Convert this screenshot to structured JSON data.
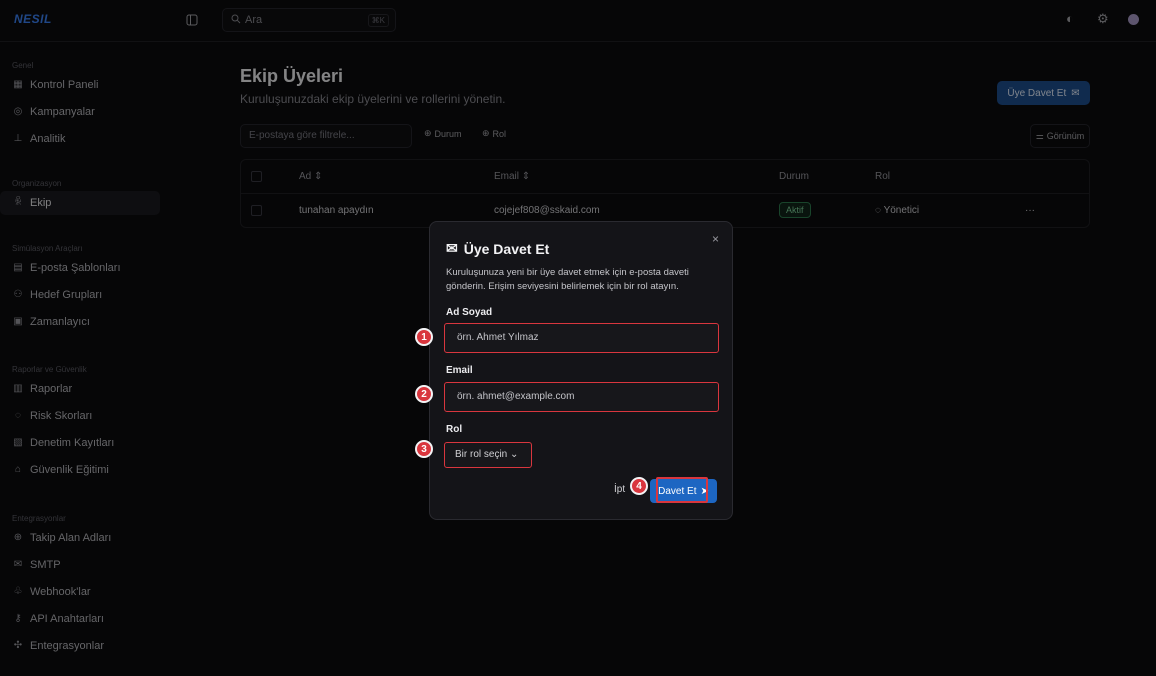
{
  "app": {
    "logo": "NESIL"
  },
  "search": {
    "placeholder": "Ara",
    "shortcut": "⌘K"
  },
  "sidebar": {
    "groups": [
      {
        "heading": "Genel",
        "items": [
          {
            "label": "Kontrol Paneli",
            "icon": "dashboard-icon"
          },
          {
            "label": "Kampanyalar",
            "icon": "target-icon"
          },
          {
            "label": "Analitik",
            "icon": "chart-icon"
          }
        ]
      },
      {
        "heading": "Organizasyon",
        "items": [
          {
            "label": "Ekip",
            "icon": "users-icon",
            "active": true
          }
        ]
      },
      {
        "heading": "Simülasyon Araçları",
        "items": [
          {
            "label": "E-posta Şablonları",
            "icon": "file-icon"
          },
          {
            "label": "Hedef Grupları",
            "icon": "group-icon"
          },
          {
            "label": "Zamanlayıcı",
            "icon": "calendar-icon"
          }
        ]
      },
      {
        "heading": "Raporlar ve Güvenlik",
        "items": [
          {
            "label": "Raporlar",
            "icon": "report-icon"
          },
          {
            "label": "Risk Skorları",
            "icon": "shield-icon"
          },
          {
            "label": "Denetim Kayıtları",
            "icon": "log-icon"
          },
          {
            "label": "Güvenlik Eğitimi",
            "icon": "graduation-icon"
          }
        ]
      },
      {
        "heading": "Entegrasyonlar",
        "items": [
          {
            "label": "Takip Alan Adları",
            "icon": "globe-icon"
          },
          {
            "label": "SMTP",
            "icon": "mail-icon"
          },
          {
            "label": "Webhook'lar",
            "icon": "webhook-icon"
          },
          {
            "label": "API Anahtarları",
            "icon": "key-icon"
          },
          {
            "label": "Entegrasyonlar",
            "icon": "puzzle-icon"
          }
        ]
      }
    ]
  },
  "page": {
    "title": "Ekip Üyeleri",
    "subtitle": "Kuruluşunuzdaki ekip üyelerini ve rollerini yönetin.",
    "invite_button": "Üye Davet Et",
    "filter_placeholder": "E-postaya göre filtrele...",
    "chip_status": "Durum",
    "chip_role": "Rol",
    "view_button": "Görünüm"
  },
  "table": {
    "headers": {
      "name": "Ad",
      "email": "Email",
      "status": "Durum",
      "role": "Rol"
    },
    "rows": [
      {
        "name": "tunahan apaydın",
        "email": "cojejef808@sskaid.com",
        "status": "Aktif",
        "role": "Yönetici",
        "actions": "···"
      }
    ]
  },
  "modal": {
    "title": "Üye Davet Et",
    "description": "Kuruluşunuza yeni bir üye davet etmek için e-posta daveti gönderin. Erişim seviyesini belirlemek için bir rol atayın.",
    "name_label": "Ad Soyad",
    "name_placeholder": "örn. Ahmet Yılmaz",
    "email_label": "Email",
    "email_placeholder": "örn. ahmet@example.com",
    "role_label": "Rol",
    "role_placeholder": "Bir rol seçin",
    "cancel": "İpt",
    "submit": "Davet Et",
    "close": "×"
  },
  "steps": [
    "1",
    "2",
    "3",
    "4"
  ],
  "colors": {
    "accent": "#1d66c2",
    "highlight": "#d9363e",
    "success": "#7fd19b"
  }
}
